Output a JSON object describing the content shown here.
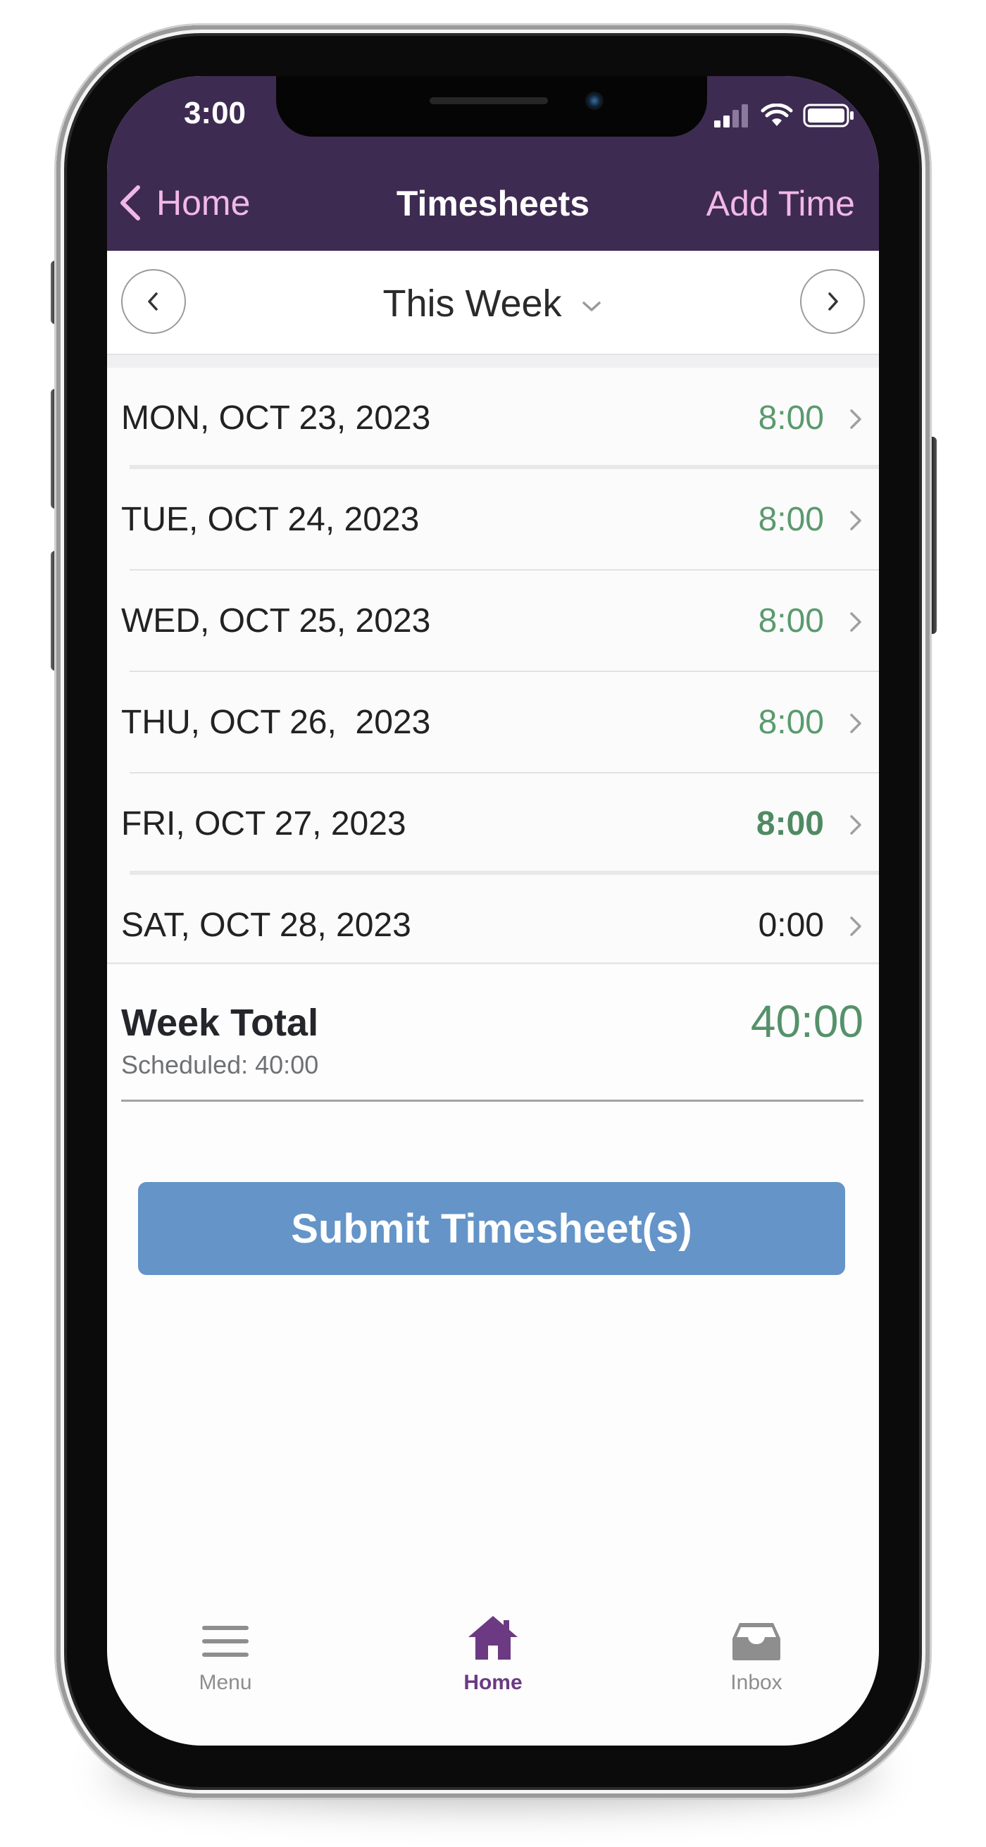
{
  "status_bar": {
    "time": "3:00"
  },
  "nav": {
    "back_label": "Home",
    "title": "Timesheets",
    "action_label": "Add Time"
  },
  "week_selector": {
    "label": "This Week"
  },
  "days": [
    {
      "date": "MON, OCT 23, 2023",
      "hours": "8:00",
      "hours_color": "#5a9a6e",
      "bold": false
    },
    {
      "date": "TUE, OCT 24, 2023",
      "hours": "8:00",
      "hours_color": "#5a9a6e",
      "bold": false
    },
    {
      "date": "WED, OCT 25, 2023",
      "hours": "8:00",
      "hours_color": "#5a9a6e",
      "bold": false
    },
    {
      "date": "THU, OCT 26,  2023",
      "hours": "8:00",
      "hours_color": "#5a9a6e",
      "bold": false
    },
    {
      "date": "FRI, OCT 27, 2023",
      "hours": "8:00",
      "hours_color": "#4f8a62",
      "bold": true
    },
    {
      "date": "SAT, OCT 28, 2023",
      "hours": "0:00",
      "hours_color": "#222222",
      "bold": false
    }
  ],
  "week_total": {
    "label": "Week Total",
    "scheduled": "Scheduled: 40:00",
    "value": "40:00"
  },
  "submit_button": {
    "label": "Submit Timesheet(s)"
  },
  "tabs": [
    {
      "label": "Menu",
      "icon": "menu-icon",
      "active": false
    },
    {
      "label": "Home",
      "icon": "home-icon",
      "active": true
    },
    {
      "label": "Inbox",
      "icon": "inbox-icon",
      "active": false
    }
  ],
  "colors": {
    "header_bg": "#3e2b52",
    "nav_link": "#f1b8e6",
    "hours_green": "#5a9a6e",
    "submit_bg": "#6494c8",
    "tab_active": "#6b3a82",
    "tab_inactive": "#8e8e8e"
  }
}
